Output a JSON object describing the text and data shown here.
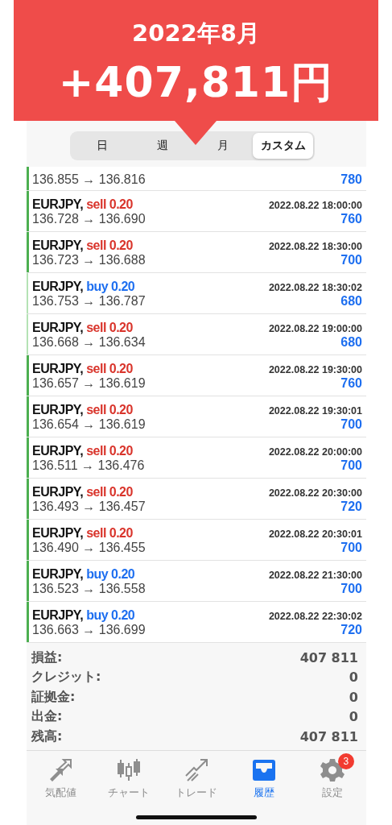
{
  "banner": {
    "title": "2022年8月",
    "amount": "+407,811円"
  },
  "segments": [
    {
      "label": "日",
      "selected": false
    },
    {
      "label": "週",
      "selected": false
    },
    {
      "label": "月",
      "selected": false
    },
    {
      "label": "カスタム",
      "selected": true
    }
  ],
  "trades": [
    {
      "prices": "136.855 → 136.816",
      "profit": "780",
      "marked": true
    },
    {
      "symbol": "EURJPY,",
      "order": "sell 0.20",
      "kind": "sell",
      "time": "2022.08.22 18:00:00",
      "prices": "136.728 → 136.690",
      "profit": "760",
      "marked": true
    },
    {
      "symbol": "EURJPY,",
      "order": "sell 0.20",
      "kind": "sell",
      "time": "2022.08.22 18:30:00",
      "prices": "136.723 → 136.688",
      "profit": "700",
      "marked": true
    },
    {
      "symbol": "EURJPY,",
      "order": "buy 0.20",
      "kind": "buy",
      "time": "2022.08.22 18:30:02",
      "prices": "136.753 → 136.787",
      "profit": "680",
      "marked": false
    },
    {
      "symbol": "EURJPY,",
      "order": "sell 0.20",
      "kind": "sell",
      "time": "2022.08.22 19:00:00",
      "prices": "136.668 → 136.634",
      "profit": "680",
      "marked": false
    },
    {
      "symbol": "EURJPY,",
      "order": "sell 0.20",
      "kind": "sell",
      "time": "2022.08.22 19:30:00",
      "prices": "136.657 → 136.619",
      "profit": "760",
      "marked": true
    },
    {
      "symbol": "EURJPY,",
      "order": "sell 0.20",
      "kind": "sell",
      "time": "2022.08.22 19:30:01",
      "prices": "136.654 → 136.619",
      "profit": "700",
      "marked": true
    },
    {
      "symbol": "EURJPY,",
      "order": "sell 0.20",
      "kind": "sell",
      "time": "2022.08.22 20:00:00",
      "prices": "136.511 → 136.476",
      "profit": "700",
      "marked": true
    },
    {
      "symbol": "EURJPY,",
      "order": "sell 0.20",
      "kind": "sell",
      "time": "2022.08.22 20:30:00",
      "prices": "136.493 → 136.457",
      "profit": "720",
      "marked": true
    },
    {
      "symbol": "EURJPY,",
      "order": "sell 0.20",
      "kind": "sell",
      "time": "2022.08.22 20:30:01",
      "prices": "136.490 → 136.455",
      "profit": "700",
      "marked": true
    },
    {
      "symbol": "EURJPY,",
      "order": "buy 0.20",
      "kind": "buy",
      "time": "2022.08.22 21:30:00",
      "prices": "136.523 → 136.558",
      "profit": "700",
      "marked": true
    },
    {
      "symbol": "EURJPY,",
      "order": "buy 0.20",
      "kind": "buy",
      "time": "2022.08.22 22:30:02",
      "prices": "136.663 → 136.699",
      "profit": "720",
      "marked": true
    }
  ],
  "summary": [
    {
      "label": "損益:",
      "value": "407 811"
    },
    {
      "label": "クレジット:",
      "value": "0"
    },
    {
      "label": "証拠金:",
      "value": "0"
    },
    {
      "label": "出金:",
      "value": "0"
    },
    {
      "label": "残高:",
      "value": "407 811"
    }
  ],
  "tab_bar": [
    {
      "label": "気配値",
      "kind": "quotes",
      "selected": false
    },
    {
      "label": "チャート",
      "kind": "chart",
      "selected": false
    },
    {
      "label": "トレード",
      "kind": "trade",
      "selected": false
    },
    {
      "label": "履歴",
      "kind": "history",
      "selected": true
    },
    {
      "label": "設定",
      "kind": "settings",
      "selected": false,
      "badge": "3"
    }
  ]
}
